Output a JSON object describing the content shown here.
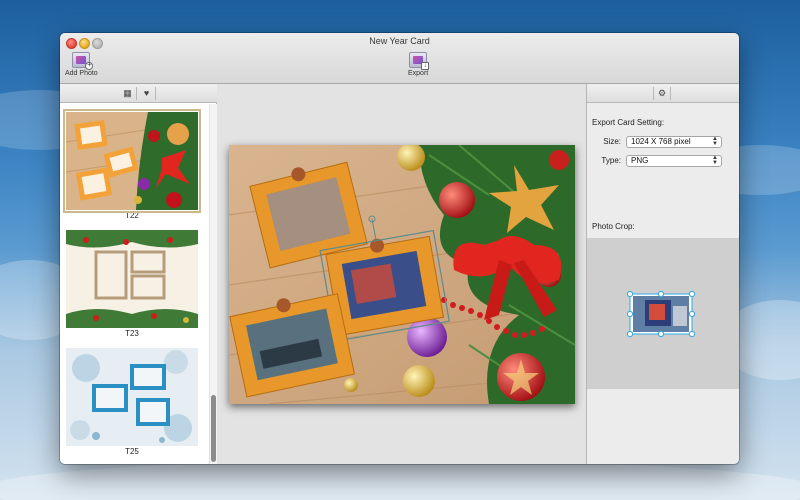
{
  "window": {
    "title": "New Year Card"
  },
  "toolbar": {
    "add_photo_label": "Add Photo",
    "add_photo_icon": "add-photo-icon",
    "export_label": "Export",
    "export_icon": "export-icon"
  },
  "left_panel": {
    "tabs": [
      {
        "icon": "grid-icon",
        "glyph": "▦"
      },
      {
        "icon": "heart-icon",
        "glyph": "♥"
      }
    ],
    "templates": [
      {
        "label": "T22",
        "selected": true
      },
      {
        "label": "T23",
        "selected": false
      },
      {
        "label": "T25",
        "selected": false
      }
    ],
    "scroll_position": 0.81
  },
  "right_panel": {
    "settings_icon": "gear-icon",
    "settings_glyph": "⚙",
    "export_heading": "Export Card Setting:",
    "size_label": "Size:",
    "size_value": "1024 X 768 pixel",
    "type_label": "Type:",
    "type_value": "PNG",
    "photo_crop_heading": "Photo Crop:"
  },
  "colors": {
    "frame_orange": "#e8982a",
    "ribbon_red": "#e0261f",
    "accent_selection": "#c9b98b",
    "crop_handle": "#33a7e0"
  }
}
